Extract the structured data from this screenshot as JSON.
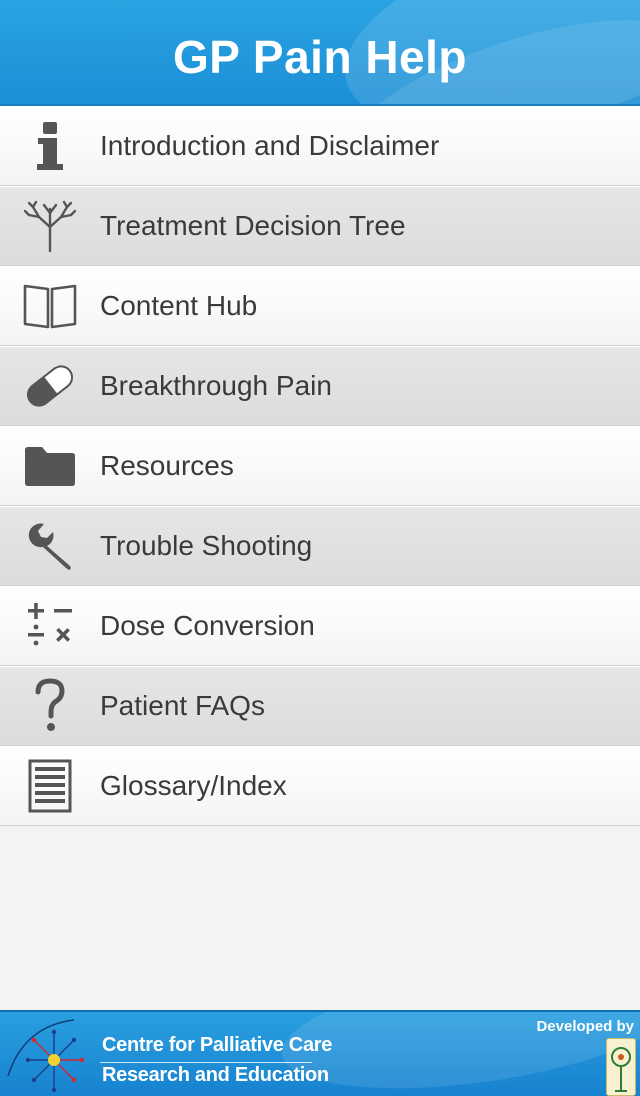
{
  "header": {
    "title": "GP Pain Help"
  },
  "menu": {
    "items": [
      {
        "label": "Introduction and Disclaimer",
        "icon": "info-icon"
      },
      {
        "label": "Treatment Decision Tree",
        "icon": "tree-icon"
      },
      {
        "label": "Content Hub",
        "icon": "book-icon"
      },
      {
        "label": "Breakthrough Pain",
        "icon": "pill-icon"
      },
      {
        "label": "Resources",
        "icon": "folder-icon"
      },
      {
        "label": "Trouble Shooting",
        "icon": "wrench-icon"
      },
      {
        "label": "Dose Conversion",
        "icon": "calculator-icon"
      },
      {
        "label": "Patient FAQs",
        "icon": "question-icon"
      },
      {
        "label": "Glossary/Index",
        "icon": "list-icon"
      }
    ]
  },
  "footer": {
    "org_line1": "Centre for Palliative Care",
    "org_line2": "Research and Education",
    "developed_by": "Developed by"
  },
  "colors": {
    "header_blue": "#1c8fd6",
    "footer_blue": "#1782cf",
    "icon_gray": "#555555",
    "text_gray": "#3a3a3a"
  }
}
